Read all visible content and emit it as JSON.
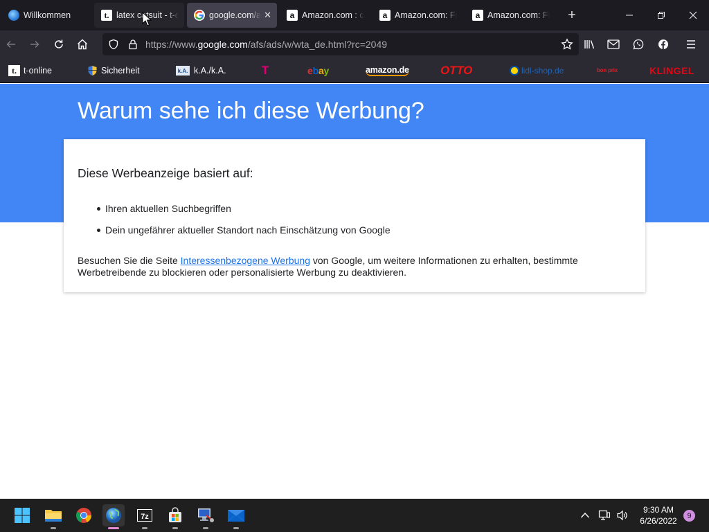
{
  "browser": {
    "tabs": [
      {
        "title": "Willkommen",
        "favicon": "globe-icon"
      },
      {
        "title": "latex catsuit - t-online",
        "favicon": "t-online-icon"
      },
      {
        "title": "google.com/afs/ads/w/wta_de.html",
        "favicon": "google-icon"
      },
      {
        "title": "Amazon.com : catsuit",
        "favicon": "amazon-icon"
      },
      {
        "title": "Amazon.com: Frauen",
        "favicon": "amazon-icon"
      },
      {
        "title": "Amazon.com: FE",
        "favicon": "amazon-icon"
      }
    ],
    "url": {
      "prefix": "https://www.",
      "host": "google.com",
      "path": "/afs/ads/w/wta_de.html?rc=2049"
    },
    "bookmarks": [
      {
        "label": "t-online",
        "icon": "t-online-icon"
      },
      {
        "label": "Sicherheit",
        "icon": "shield-icon"
      },
      {
        "label": "k.A./k.A.",
        "icon": "ka-icon"
      },
      {
        "label": "T",
        "icon": "telekom-logo"
      },
      {
        "label": "ebay",
        "icon": "ebay-logo"
      },
      {
        "label": "amazon.de",
        "icon": "amazon-logo"
      },
      {
        "label": "OTTO",
        "icon": "otto-logo"
      },
      {
        "label": "lidl-shop.de",
        "icon": "lidl-icon"
      },
      {
        "label": "bon prix",
        "icon": "bonprix-logo"
      },
      {
        "label": "KLINGEL",
        "icon": "klingel-logo"
      }
    ],
    "colors": {
      "tab_bg": "#1c1b22",
      "toolbar_bg": "#2b2a33",
      "active_tab": "#42414d"
    }
  },
  "content": {
    "title": "Warum sehe ich diese Werbung?",
    "card_heading": "Diese Werbeanzeige basiert auf:",
    "reasons": [
      "Ihren aktuellen Suchbegriffen",
      "Dein ungefährer aktueller Standort nach Einschätzung von Google"
    ],
    "info_before": "Besuchen Sie die Seite ",
    "info_link": "Interessenbezogene Werbung",
    "info_after": " von Google, um weitere Informationen zu erhalten, bestimmte Werbetreibende zu blockieren oder personalisierte Werbung zu deaktivieren.",
    "colors": {
      "hero": "#4285f4",
      "link": "#1a73e8"
    }
  },
  "taskbar": {
    "apps": [
      "start-icon",
      "file-explorer-icon",
      "chrome-icon",
      "firefox-globe-icon",
      "7zip-icon",
      "store-icon",
      "network-app-icon",
      "mail-icon"
    ],
    "time": "9:30 AM",
    "date": "6/26/2022",
    "notification_count": "9"
  }
}
